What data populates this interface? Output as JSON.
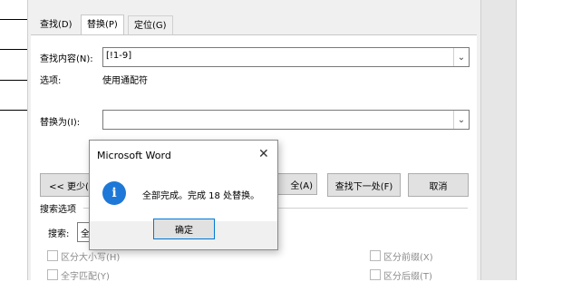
{
  "dialog": {
    "tabs": [
      {
        "label": "查找(D)"
      },
      {
        "label": "替换(P)"
      },
      {
        "label": "定位(G)"
      }
    ],
    "find": {
      "label": "查找内容(N):",
      "value": "[!1-9]"
    },
    "options": {
      "label": "选项:",
      "value": "使用通配符"
    },
    "replace": {
      "label": "替换为(I):",
      "value": ""
    },
    "buttons": {
      "less": "<< 更少(",
      "replace_all_partial": "全(A)",
      "find_next": "查找下一处(F)",
      "cancel": "取消"
    },
    "search_options": {
      "title": "搜索选项",
      "search_label": "搜索:",
      "search_value": "全",
      "checks": {
        "match_case": "区分大小写(H)",
        "whole_word": "全字匹配(Y)",
        "match_prefix": "区分前缀(X)",
        "match_suffix": "区分后缀(T)"
      }
    }
  },
  "messagebox": {
    "title": "Microsoft Word",
    "message": "全部完成。完成 18 处替换。",
    "ok": "确定",
    "icon": "info-icon"
  }
}
